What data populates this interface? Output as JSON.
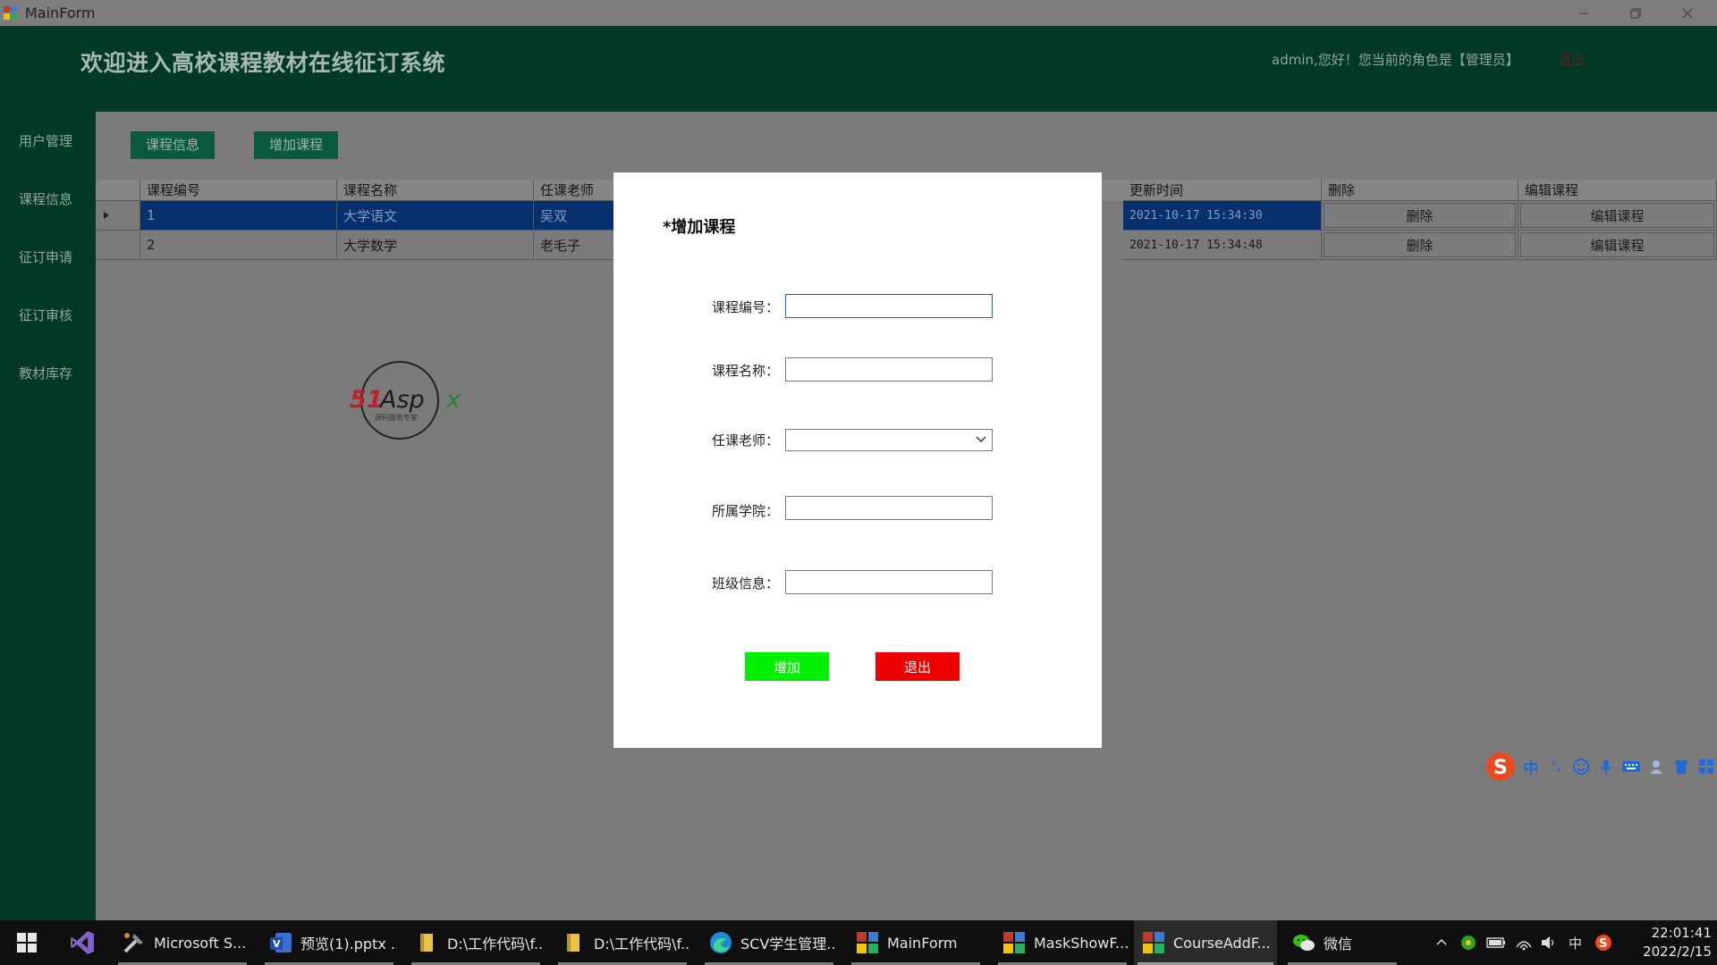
{
  "window": {
    "title": "MainForm"
  },
  "header": {
    "system_title": "欢迎进入高校课程教材在线征订系统",
    "welcome_text": "admin,您好！您当前的角色是【管理员】",
    "logout_label": "退出"
  },
  "sidebar": {
    "items": [
      {
        "label": "用户管理"
      },
      {
        "label": "课程信息"
      },
      {
        "label": "征订申请"
      },
      {
        "label": "征订审核"
      },
      {
        "label": "教材库存"
      }
    ]
  },
  "toolbar": {
    "course_info_label": "课程信息",
    "add_course_label": "增加课程"
  },
  "grid": {
    "columns": [
      "课程编号",
      "课程名称",
      "任课老师",
      "更新时间",
      "删除",
      "编辑课程"
    ],
    "rows": [
      {
        "id": "1",
        "name": "大学语文",
        "teacher": "吴双",
        "updated": "2021-10-17 15:34:30",
        "delete_label": "删除",
        "edit_label": "编辑课程",
        "selected": true
      },
      {
        "id": "2",
        "name": "大学数学",
        "teacher": "老毛子",
        "updated": "2021-10-17 15:34:48",
        "delete_label": "删除",
        "edit_label": "编辑课程",
        "selected": false
      }
    ]
  },
  "watermark": {
    "brand": "51Aspx",
    "tagline": "源码服务专家"
  },
  "dialog": {
    "title": "*增加课程",
    "fields": [
      {
        "label": "课程编号：",
        "value": ""
      },
      {
        "label": "课程名称：",
        "value": ""
      },
      {
        "label": "任课老师：",
        "value": ""
      },
      {
        "label": "所属学院：",
        "value": ""
      },
      {
        "label": "班级信息：",
        "value": ""
      }
    ],
    "add_label": "增加",
    "exit_label": "退出",
    "add_color": "#00f000",
    "exit_color": "#ee0000"
  },
  "ime": {
    "mode": "中",
    "punct": "°,"
  },
  "taskbar": {
    "items": [
      {
        "label": "Microsoft S..."
      },
      {
        "label": "预览(1).pptx ..."
      },
      {
        "label": "D:\\工作代码\\f..."
      },
      {
        "label": "D:\\工作代码\\f..."
      },
      {
        "label": "SCV学生管理..."
      },
      {
        "label": "MainForm"
      },
      {
        "label": "MaskShowF..."
      },
      {
        "label": "CourseAddF..."
      },
      {
        "label": "微信"
      }
    ],
    "tray_lang": "中",
    "time": "22:01:41",
    "date": "2022/2/15"
  },
  "colors": {
    "header_bg": "#003a27",
    "selected_row": "#06306e",
    "toolbar_btn": "#0c5a3e"
  }
}
